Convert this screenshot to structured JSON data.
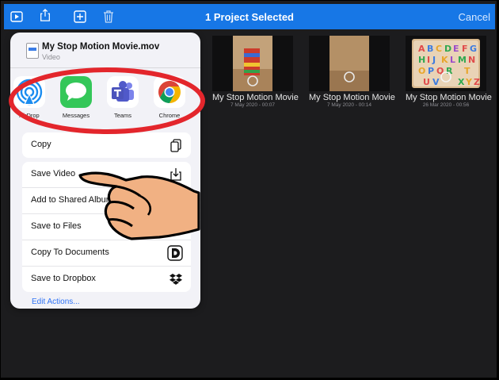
{
  "topbar": {
    "title": "1 Project Selected",
    "cancel": "Cancel",
    "icons": [
      "play-icon",
      "share-icon",
      "add-icon",
      "trash-icon"
    ],
    "accent": "#1777e6"
  },
  "thumbnails": [
    {
      "name": "My Stop Motion Movie",
      "date": "7 May 2020 - 00:07"
    },
    {
      "name": "My Stop Motion Movie",
      "date": "7 May 2020 - 00:14"
    },
    {
      "name": "My Stop Motion Movie",
      "date": "26 Mar 2020 - 00:56"
    }
  ],
  "share_sheet": {
    "file_name": "My Stop Motion Movie.mov",
    "file_type": "Video",
    "apps": [
      {
        "label": "AirDrop",
        "icon": "airdrop-icon"
      },
      {
        "label": "Messages",
        "icon": "messages-icon"
      },
      {
        "label": "Teams",
        "icon": "teams-icon"
      },
      {
        "label": "Chrome",
        "icon": "chrome-icon"
      }
    ],
    "copy": {
      "label": "Copy",
      "icon": "copy-icon"
    },
    "actions": [
      {
        "label": "Save Video",
        "icon": "save-icon"
      },
      {
        "label": "Add to Shared Album",
        "icon": "shared-album-icon"
      },
      {
        "label": "Save to Files",
        "icon": "folder-icon"
      },
      {
        "label": "Copy To Documents",
        "icon": "documents-icon"
      },
      {
        "label": "Save to Dropbox",
        "icon": "dropbox-icon"
      }
    ],
    "edit_actions": "Edit Actions..."
  },
  "annotation": {
    "highlight_color": "#e3262c",
    "hand_color": "#f1b183"
  }
}
